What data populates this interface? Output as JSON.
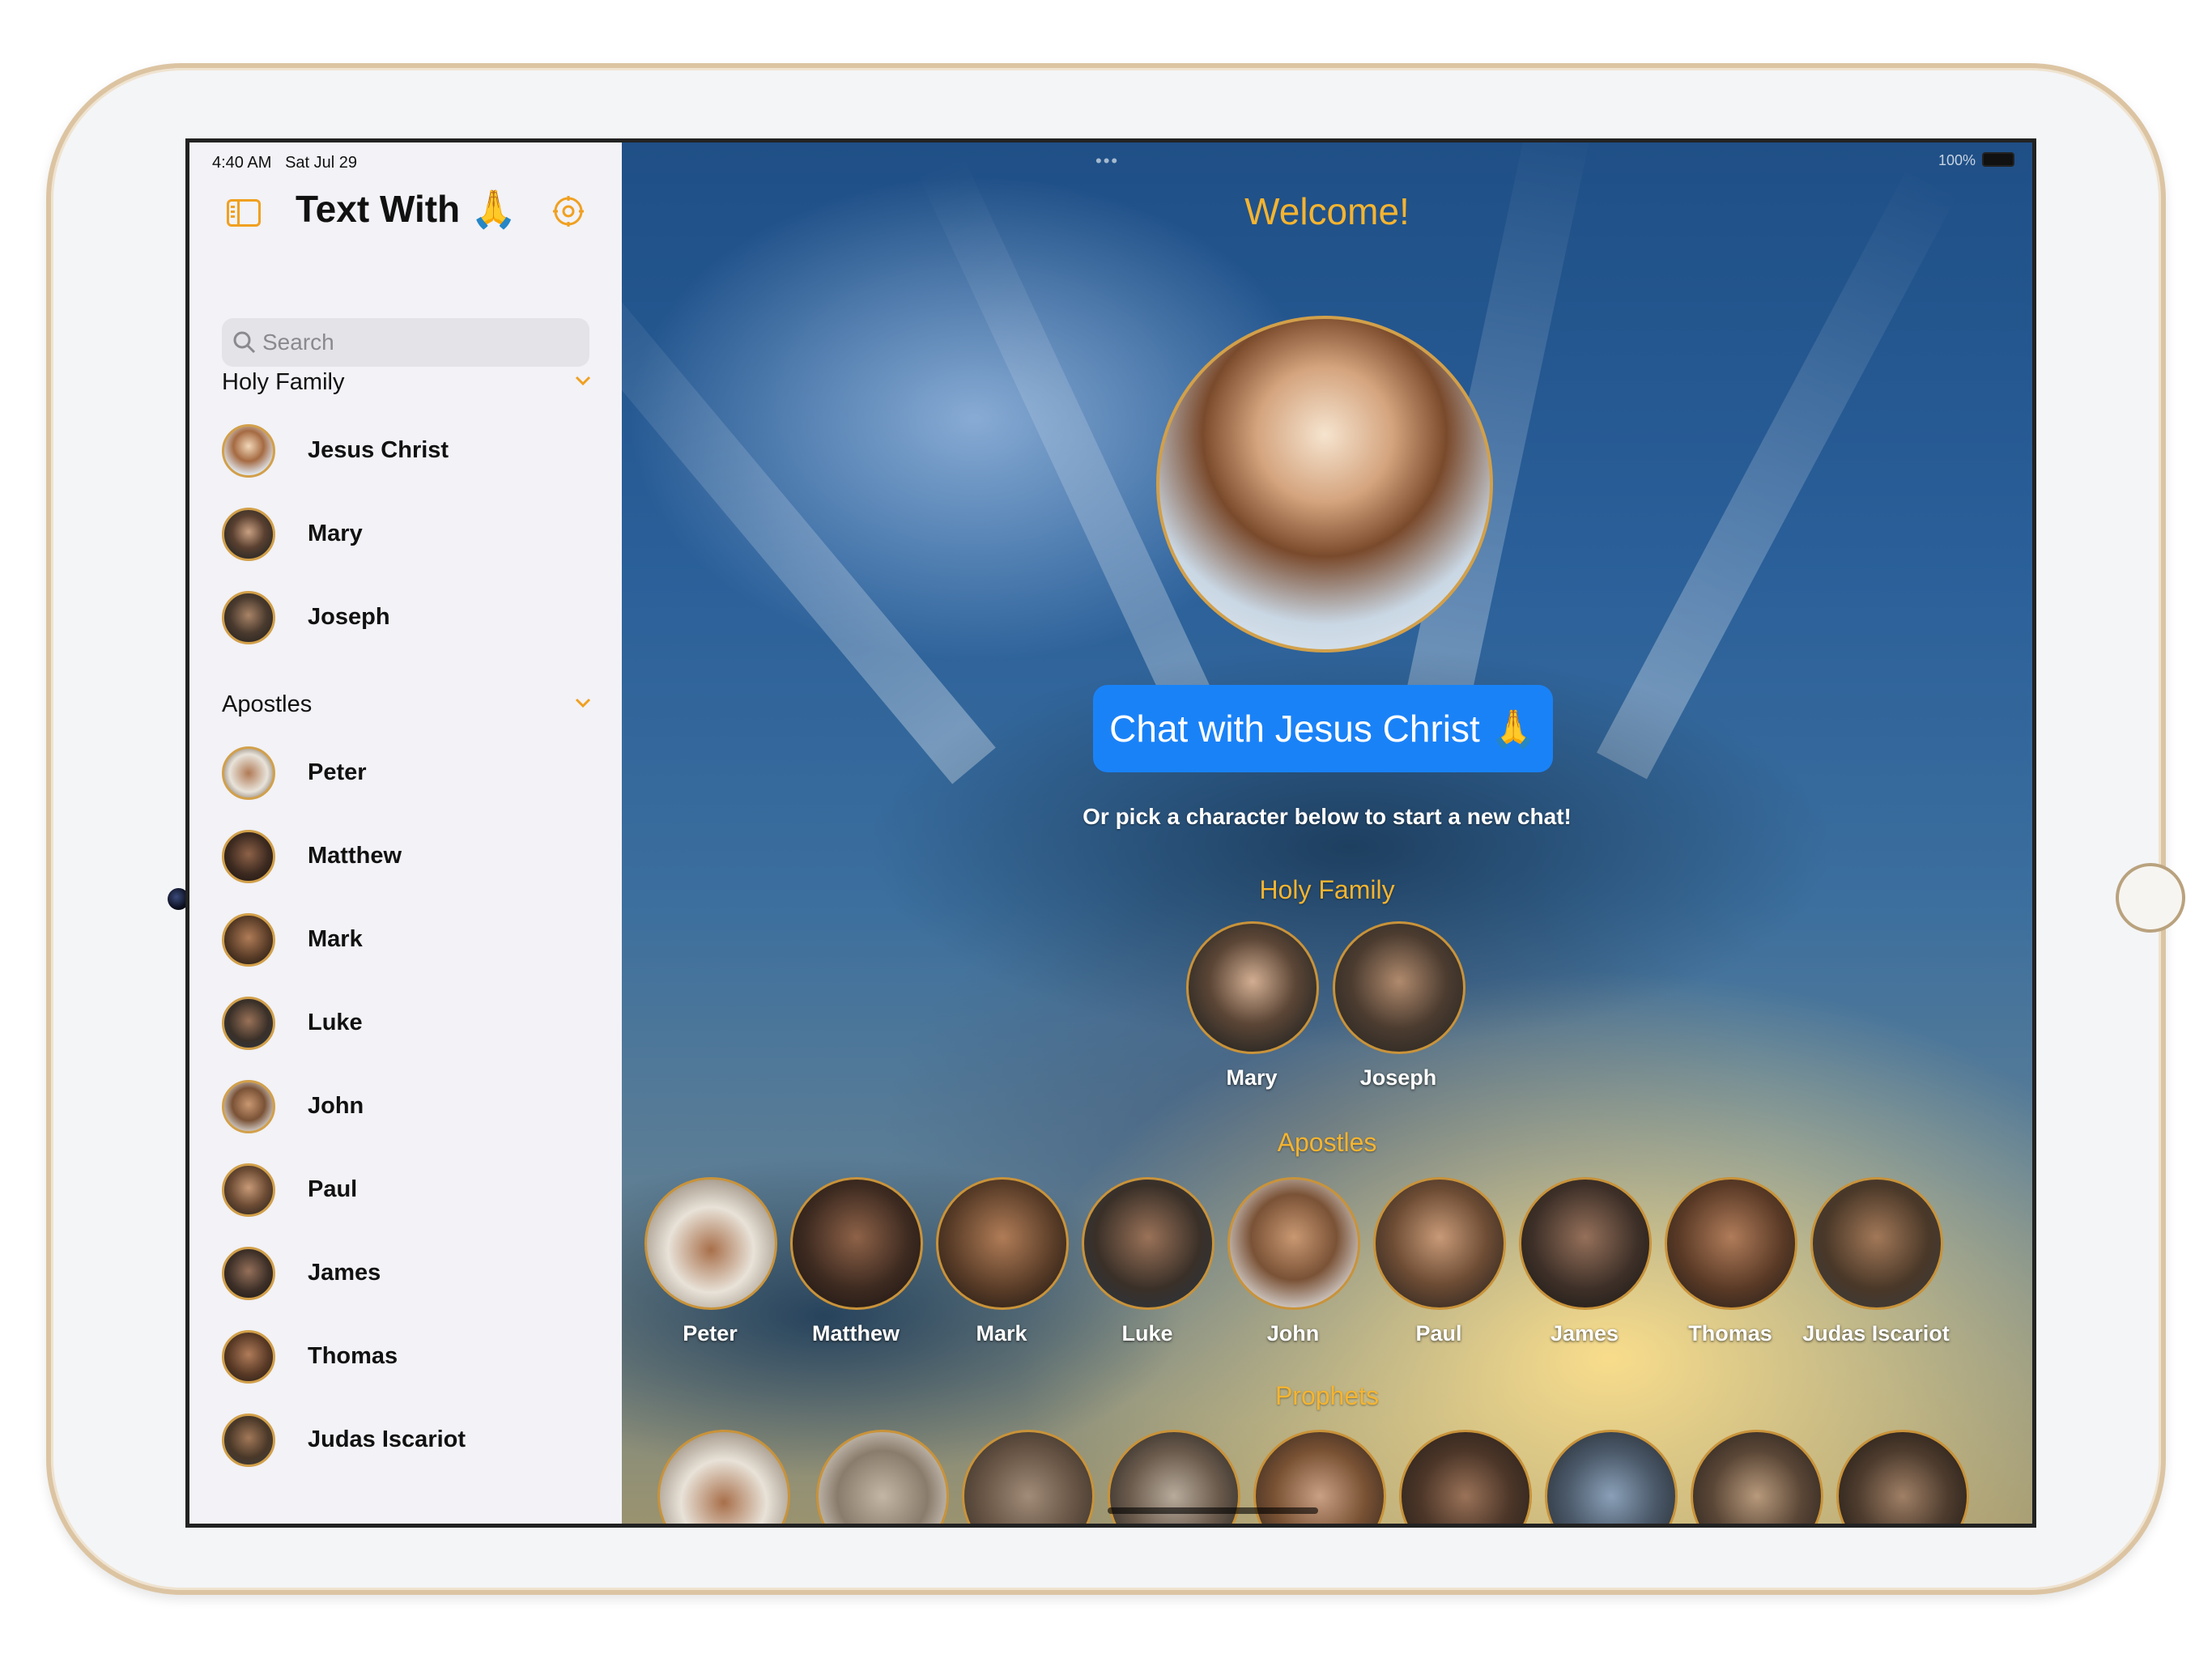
{
  "status_bar": {
    "time": "4:40 AM",
    "date": "Sat Jul 29",
    "battery": "100%"
  },
  "sidebar": {
    "title": "Text With 🙏",
    "search_placeholder": "Search",
    "sections": [
      {
        "header": "Holy Family",
        "items": [
          "Jesus Christ",
          "Mary",
          "Joseph"
        ]
      },
      {
        "header": "Apostles",
        "items": [
          "Peter",
          "Matthew",
          "Mark",
          "Luke",
          "John",
          "Paul",
          "James",
          "Thomas",
          "Judas Iscariot"
        ]
      }
    ]
  },
  "main": {
    "welcome": "Welcome!",
    "chat_button": "Chat with Jesus Christ 🙏",
    "subtext": "Or pick a character below to start a new chat!",
    "groups": [
      {
        "title": "Holy Family",
        "members": [
          "Mary",
          "Joseph"
        ]
      },
      {
        "title": "Apostles",
        "members": [
          "Peter",
          "Matthew",
          "Mark",
          "Luke",
          "John",
          "Paul",
          "James",
          "Thomas",
          "Judas Iscariot"
        ]
      },
      {
        "title": "Prophets",
        "members": []
      }
    ]
  },
  "colors": {
    "accent": "#f5b430",
    "button_blue": "#1a82f7",
    "sidebar_bg": "#f2f2f7"
  },
  "icons": [
    "sidebar-toggle-icon",
    "settings-icon",
    "search-icon",
    "chevron-down-icon",
    "wifi-icon",
    "battery-icon"
  ]
}
